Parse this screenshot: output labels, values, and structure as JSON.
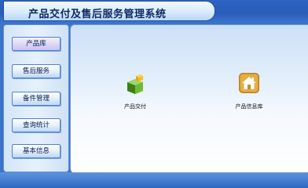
{
  "header": {
    "title": "产品交付及售后服务管理系统"
  },
  "sidebar": {
    "items": [
      {
        "label": "产品库"
      },
      {
        "label": "售后服务"
      },
      {
        "label": "备件管理"
      },
      {
        "label": "查询统计"
      },
      {
        "label": "基本信息"
      }
    ],
    "active_index": 0
  },
  "main": {
    "tiles": [
      {
        "label": "产品交付",
        "icon": "product-delivery-icon"
      },
      {
        "label": "产品信息库",
        "icon": "product-info-library-icon"
      }
    ]
  },
  "colors": {
    "background": "#3b73c9",
    "header_panel": "#d9ebfc",
    "button_border": "#4d82cf",
    "active_button": "#ded8f8"
  }
}
